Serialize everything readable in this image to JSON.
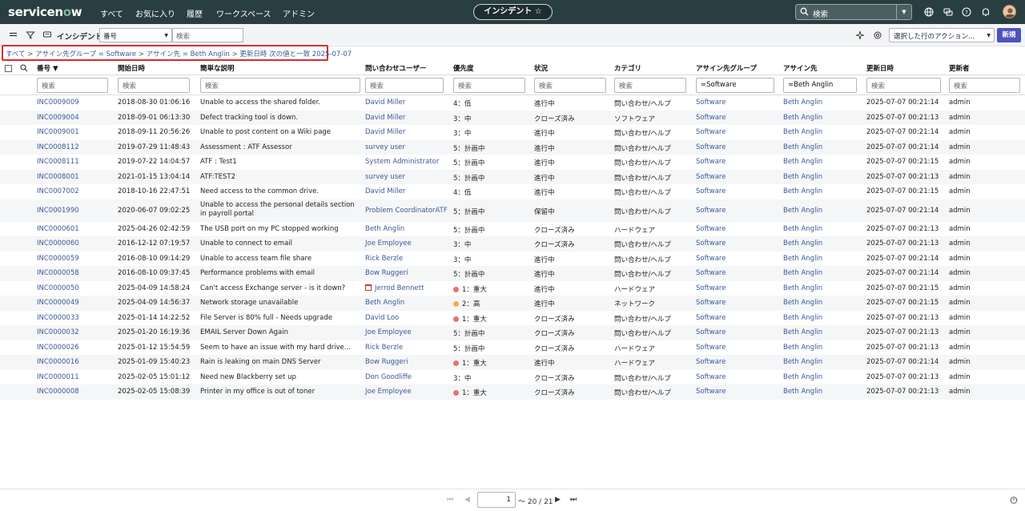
{
  "topnav": {
    "logo_a": "servicen",
    "logo_o": "o",
    "logo_b": "w",
    "links": [
      "すべて",
      "お気に入り",
      "履歴",
      "ワークスペース",
      "アドミン"
    ],
    "context": "インシデント ☆",
    "search_label": "検索"
  },
  "toolbar": {
    "title": "インシデント",
    "field_select": "番号",
    "search_placeholder": "検索",
    "action_select": "選択した行のアクション...",
    "new_button": "新規"
  },
  "breadcrumb": {
    "parts": [
      "すべて",
      "アサイン先グループ = Software",
      "アサイン先 = Beth Anglin",
      "更新日時 次の値と一致 2025-07-07"
    ]
  },
  "columns": [
    {
      "label": "番号 ▼",
      "filter": "検索"
    },
    {
      "label": "開始日時",
      "filter": "検索"
    },
    {
      "label": "簡単な説明",
      "filter": "検索"
    },
    {
      "label": "問い合わせユーザー",
      "filter": "検索"
    },
    {
      "label": "優先度",
      "filter": "検索"
    },
    {
      "label": "状況",
      "filter": "検索"
    },
    {
      "label": "カテゴリ",
      "filter": "検索"
    },
    {
      "label": "アサイン先グループ",
      "filter": "=Software"
    },
    {
      "label": "アサイン先",
      "filter": "=Beth Anglin"
    },
    {
      "label": "更新日時",
      "filter": "検索"
    },
    {
      "label": "更新者",
      "filter": "検索"
    }
  ],
  "rows": [
    {
      "number": "INC0009009",
      "opened": "2018-08-30 01:06:16",
      "desc": "Unable to access the shared folder.",
      "caller": "David Miller",
      "priority": "4：低",
      "pdot": "",
      "state": "進行中",
      "category": "問い合わせ/ヘルプ",
      "group": "Software",
      "assigned": "Beth Anglin",
      "updated": "2025-07-07 00:21:14",
      "updated_by": "admin"
    },
    {
      "number": "INC0009004",
      "opened": "2018-09-01 06:13:30",
      "desc": "Defect tracking tool is down.",
      "caller": "David Miller",
      "priority": "3：中",
      "pdot": "",
      "state": "クローズ済み",
      "category": "ソフトウェア",
      "group": "Software",
      "assigned": "Beth Anglin",
      "updated": "2025-07-07 00:21:13",
      "updated_by": "admin"
    },
    {
      "number": "INC0009001",
      "opened": "2018-09-11 20:56:26",
      "desc": "Unable to post content on a Wiki page",
      "caller": "David Miller",
      "priority": "3：中",
      "pdot": "",
      "state": "進行中",
      "category": "問い合わせ/ヘルプ",
      "group": "Software",
      "assigned": "Beth Anglin",
      "updated": "2025-07-07 00:21:14",
      "updated_by": "admin"
    },
    {
      "number": "INC0008112",
      "opened": "2019-07-29 11:48:43",
      "desc": "Assessment : ATF Assessor",
      "caller": "survey user",
      "priority": "5：計画中",
      "pdot": "",
      "state": "進行中",
      "category": "問い合わせ/ヘルプ",
      "group": "Software",
      "assigned": "Beth Anglin",
      "updated": "2025-07-07 00:21:14",
      "updated_by": "admin"
    },
    {
      "number": "INC0008111",
      "opened": "2019-07-22 14:04:57",
      "desc": "ATF : Test1",
      "caller": "System Administrator",
      "priority": "5：計画中",
      "pdot": "",
      "state": "進行中",
      "category": "問い合わせ/ヘルプ",
      "group": "Software",
      "assigned": "Beth Anglin",
      "updated": "2025-07-07 00:21:15",
      "updated_by": "admin"
    },
    {
      "number": "INC0008001",
      "opened": "2021-01-15 13:04:14",
      "desc": "ATF:TEST2",
      "caller": "survey user",
      "priority": "5：計画中",
      "pdot": "",
      "state": "進行中",
      "category": "問い合わせ/ヘルプ",
      "group": "Software",
      "assigned": "Beth Anglin",
      "updated": "2025-07-07 00:21:13",
      "updated_by": "admin"
    },
    {
      "number": "INC0007002",
      "opened": "2018-10-16 22:47:51",
      "desc": "Need access to the common drive.",
      "caller": "David Miller",
      "priority": "4：低",
      "pdot": "",
      "state": "進行中",
      "category": "問い合わせ/ヘルプ",
      "group": "Software",
      "assigned": "Beth Anglin",
      "updated": "2025-07-07 00:21:15",
      "updated_by": "admin"
    },
    {
      "number": "INC0001990",
      "opened": "2020-06-07 09:02:25",
      "desc": "Unable to access the personal details section in payroll portal",
      "caller": "Problem CoordinatorATF",
      "priority": "5：計画中",
      "pdot": "",
      "state": "保留中",
      "category": "問い合わせ/ヘルプ",
      "group": "Software",
      "assigned": "Beth Anglin",
      "updated": "2025-07-07 00:21:14",
      "updated_by": "admin"
    },
    {
      "number": "INC0000601",
      "opened": "2025-04-26 02:42:59",
      "desc": "The USB port on my PC stopped working",
      "caller": "Beth Anglin",
      "priority": "5：計画中",
      "pdot": "",
      "state": "クローズ済み",
      "category": "ハードウェア",
      "group": "Software",
      "assigned": "Beth Anglin",
      "updated": "2025-07-07 00:21:13",
      "updated_by": "admin"
    },
    {
      "number": "INC0000060",
      "opened": "2016-12-12 07:19:57",
      "desc": "Unable to connect to email",
      "caller": "Joe Employee",
      "priority": "3：中",
      "pdot": "",
      "state": "クローズ済み",
      "category": "問い合わせ/ヘルプ",
      "group": "Software",
      "assigned": "Beth Anglin",
      "updated": "2025-07-07 00:21:13",
      "updated_by": "admin"
    },
    {
      "number": "INC0000059",
      "opened": "2016-08-10 09:14:29",
      "desc": "Unable to access team file share",
      "caller": "Rick Berzle",
      "priority": "3：中",
      "pdot": "",
      "state": "進行中",
      "category": "問い合わせ/ヘルプ",
      "group": "Software",
      "assigned": "Beth Anglin",
      "updated": "2025-07-07 00:21:14",
      "updated_by": "admin"
    },
    {
      "number": "INC0000058",
      "opened": "2016-08-10 09:37:45",
      "desc": "Performance problems with email",
      "caller": "Bow Ruggeri",
      "priority": "5：計画中",
      "pdot": "",
      "state": "進行中",
      "category": "問い合わせ/ヘルプ",
      "group": "Software",
      "assigned": "Beth Anglin",
      "updated": "2025-07-07 00:21:14",
      "updated_by": "admin"
    },
    {
      "number": "INC0000050",
      "opened": "2025-04-09 14:58:24",
      "desc": "Can't access Exchange server - is it down?",
      "caller": "Jerrod Bennett",
      "caller_icon": true,
      "priority": "1：重大",
      "pdot": "red",
      "state": "進行中",
      "category": "ハードウェア",
      "group": "Software",
      "assigned": "Beth Anglin",
      "updated": "2025-07-07 00:21:15",
      "updated_by": "admin"
    },
    {
      "number": "INC0000049",
      "opened": "2025-04-09 14:56:37",
      "desc": "Network storage unavailable",
      "caller": "Beth Anglin",
      "priority": "2：高",
      "pdot": "orange",
      "state": "進行中",
      "category": "ネットワーク",
      "group": "Software",
      "assigned": "Beth Anglin",
      "updated": "2025-07-07 00:21:15",
      "updated_by": "admin"
    },
    {
      "number": "INC0000033",
      "opened": "2025-01-14 14:22:52",
      "desc": "File Server is 80% full - Needs upgrade",
      "caller": "David Loo",
      "priority": "1：重大",
      "pdot": "red",
      "state": "クローズ済み",
      "category": "問い合わせ/ヘルプ",
      "group": "Software",
      "assigned": "Beth Anglin",
      "updated": "2025-07-07 00:21:13",
      "updated_by": "admin"
    },
    {
      "number": "INC0000032",
      "opened": "2025-01-20 16:19:36",
      "desc": "EMAIL Server Down Again",
      "caller": "Joe Employee",
      "priority": "5：計画中",
      "pdot": "",
      "state": "クローズ済み",
      "category": "問い合わせ/ヘルプ",
      "group": "Software",
      "assigned": "Beth Anglin",
      "updated": "2025-07-07 00:21:13",
      "updated_by": "admin"
    },
    {
      "number": "INC0000026",
      "opened": "2025-01-12 15:54:59",
      "desc": "Seem to have an issue with my hard drive...",
      "caller": "Rick Berzle",
      "priority": "5：計画中",
      "pdot": "",
      "state": "クローズ済み",
      "category": "ハードウェア",
      "group": "Software",
      "assigned": "Beth Anglin",
      "updated": "2025-07-07 00:21:13",
      "updated_by": "admin"
    },
    {
      "number": "INC0000016",
      "opened": "2025-01-09 15:40:23",
      "desc": "Rain is leaking on main DNS Server",
      "caller": "Bow Ruggeri",
      "priority": "1：重大",
      "pdot": "red",
      "state": "進行中",
      "category": "ハードウェア",
      "group": "Software",
      "assigned": "Beth Anglin",
      "updated": "2025-07-07 00:21:14",
      "updated_by": "admin"
    },
    {
      "number": "INC0000011",
      "opened": "2025-02-05 15:01:12",
      "desc": "Need new Blackberry set up",
      "caller": "Don Goodliffe",
      "priority": "3：中",
      "pdot": "",
      "state": "クローズ済み",
      "category": "問い合わせ/ヘルプ",
      "group": "Software",
      "assigned": "Beth Anglin",
      "updated": "2025-07-07 00:21:13",
      "updated_by": "admin"
    },
    {
      "number": "INC0000008",
      "opened": "2025-02-05 15:08:39",
      "desc": "Printer in my office is out of toner",
      "caller": "Joe Employee",
      "priority": "1：重大",
      "pdot": "red",
      "state": "クローズ済み",
      "category": "問い合わせ/ヘルプ",
      "group": "Software",
      "assigned": "Beth Anglin",
      "updated": "2025-07-07 00:21:13",
      "updated_by": "admin"
    }
  ],
  "pager": {
    "page_value": "1",
    "range_text": "〜 20 / 21"
  }
}
